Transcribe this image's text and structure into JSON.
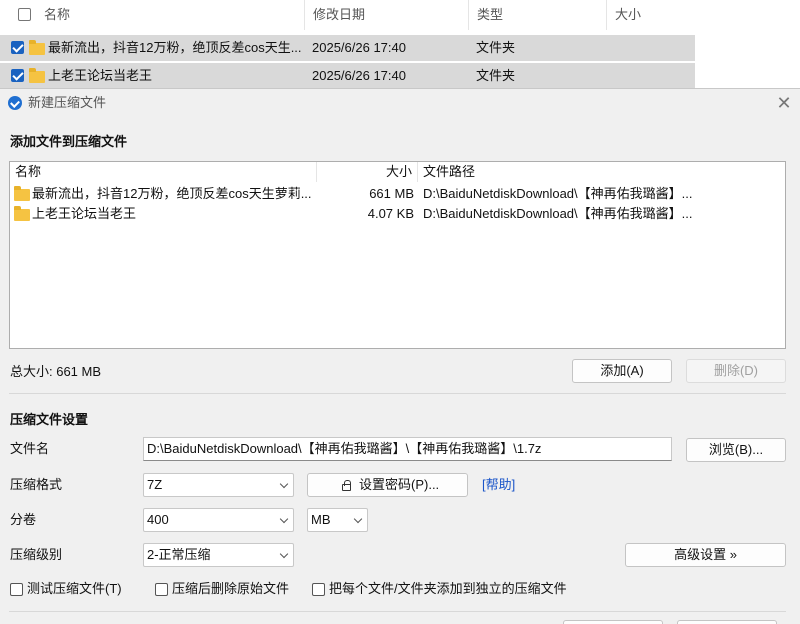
{
  "explorer": {
    "columns": {
      "name": "名称",
      "modified": "修改日期",
      "type": "类型",
      "size": "大小"
    },
    "rows": [
      {
        "name": "最新流出，抖音12万粉，绝顶反差cos天生...",
        "modified": "2025/6/26 17:40",
        "type": "文件夹"
      },
      {
        "name": "上老王论坛当老王",
        "modified": "2025/6/26 17:40",
        "type": "文件夹"
      }
    ]
  },
  "dialog": {
    "title": "新建压缩文件",
    "add_section_title": "添加文件到压缩文件",
    "list_columns": {
      "name": "名称",
      "size": "大小",
      "path": "文件路径"
    },
    "files": [
      {
        "name": "最新流出，抖音12万粉，绝顶反差cos天生萝莉...",
        "size": "661 MB",
        "path": "D:\\BaiduNetdiskDownload\\【神再佑我璐酱】..."
      },
      {
        "name": "上老王论坛当老王",
        "size": "4.07 KB",
        "path": "D:\\BaiduNetdiskDownload\\【神再佑我璐酱】..."
      }
    ],
    "total_size": "总大小: 661 MB",
    "add_button": "添加(A)",
    "delete_button": "删除(D)",
    "settings_title": "压缩文件设置",
    "filename_label": "文件名",
    "filename_value": "D:\\BaiduNetdiskDownload\\【神再佑我璐酱】\\【神再佑我璐酱】\\1.7z",
    "browse_button": "浏览(B)...",
    "format_label": "压缩格式",
    "format_value": "7Z",
    "password_button": "设置密码(P)...",
    "help_link": "[帮助]",
    "split_label": "分卷",
    "split_value": "400",
    "split_unit": "MB",
    "level_label": "压缩级别",
    "level_value": "2-正常压缩",
    "advanced_button": "高级设置 »",
    "options": [
      {
        "label": "测试压缩文件(T)",
        "checked": false
      },
      {
        "label": "压缩后删除原始文件",
        "checked": false
      },
      {
        "label": "把每个文件/文件夹添加到独立的压缩文件",
        "checked": false
      }
    ]
  }
}
